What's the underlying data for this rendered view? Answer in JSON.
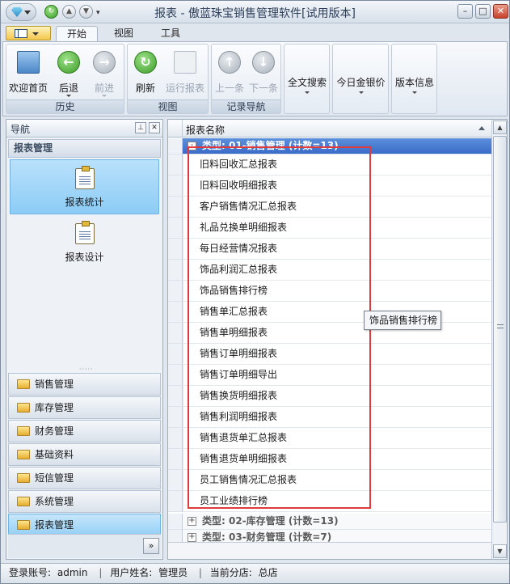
{
  "window": {
    "title": "报表 - 傲蓝珠宝销售管理软件[试用版本]"
  },
  "tabs": [
    {
      "label": "开始",
      "active": true
    },
    {
      "label": "视图",
      "active": false
    },
    {
      "label": "工具",
      "active": false
    }
  ],
  "ribbon": {
    "groups": {
      "history": "历史",
      "view": "视图",
      "record_nav": "记录导航"
    },
    "buttons": {
      "welcome": "欢迎首页",
      "back": "后退",
      "forward": "前进",
      "refresh": "刷新",
      "run_report": "运行报表",
      "prev": "上一条",
      "next": "下一条",
      "search": "全文搜索",
      "gold_price": "今日金银价",
      "version": "版本信息"
    }
  },
  "nav": {
    "header": "导航",
    "section_title": "报表管理",
    "items": [
      {
        "label": "报表统计",
        "selected": true
      },
      {
        "label": "报表设计",
        "selected": false
      }
    ],
    "modules": [
      {
        "label": "销售管理",
        "active": false
      },
      {
        "label": "库存管理",
        "active": false
      },
      {
        "label": "财务管理",
        "active": false
      },
      {
        "label": "基础资料",
        "active": false
      },
      {
        "label": "短信管理",
        "active": false
      },
      {
        "label": "系统管理",
        "active": false
      },
      {
        "label": "报表管理",
        "active": true
      }
    ],
    "more_glyph": "»"
  },
  "grid": {
    "column": "报表名称",
    "groups": [
      {
        "label": "类型: 01-销售管理 (计数=13)",
        "expanded": true,
        "toggle": "-"
      },
      {
        "label": "类型: 02-库存管理 (计数=13)",
        "expanded": false,
        "toggle": "+"
      },
      {
        "label": "类型: 03-财务管理 (计数=7)",
        "expanded": false,
        "toggle": "+"
      }
    ],
    "rows": [
      "旧料回收汇总报表",
      "旧料回收明细报表",
      "客户销售情况汇总报表",
      "礼品兑换单明细报表",
      "每日经营情况报表",
      "饰品利润汇总报表",
      "饰品销售排行榜",
      "销售单汇总报表",
      "销售单明细报表",
      "销售订单明细报表",
      "销售订单明细导出",
      "销售换货明细报表",
      "销售利润明细报表",
      "销售退货单汇总报表",
      "销售退货单明细报表",
      "员工销售情况汇总报表",
      "员工业绩排行榜"
    ],
    "tooltip": "饰品销售排行榜",
    "highlight_color": "#e03a3a"
  },
  "status": {
    "account_label": "登录账号:",
    "account": "admin",
    "user_label": "用户姓名:",
    "user": "管理员",
    "branch_label": "当前分店:",
    "branch": "总店"
  }
}
